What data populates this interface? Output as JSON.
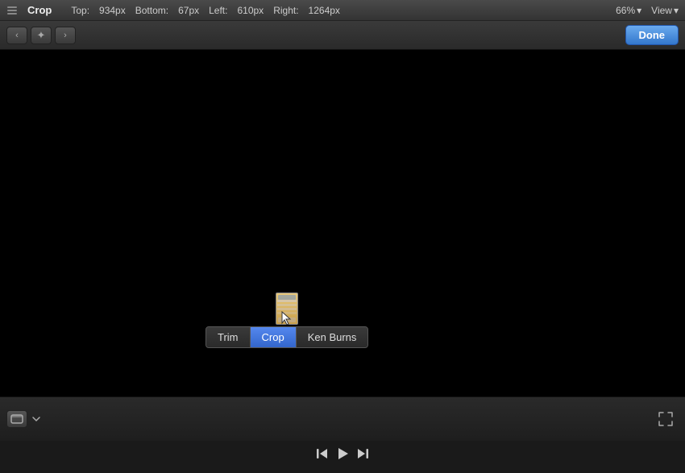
{
  "titlebar": {
    "drag_icon": "drag-icon",
    "title": "Crop",
    "top_label": "Top:",
    "top_value": "934px",
    "bottom_label": "Bottom:",
    "bottom_value": "67px",
    "left_label": "Left:",
    "left_value": "610px",
    "right_label": "Right:",
    "right_value": "1264px",
    "zoom": "66%",
    "zoom_dropdown": "▾",
    "view_label": "View",
    "view_dropdown": "▾"
  },
  "toolbar": {
    "prev_label": "‹",
    "center_label": "✦",
    "next_label": "›",
    "done_label": "Done"
  },
  "popup": {
    "trim_label": "Trim",
    "crop_label": "Crop",
    "ken_burns_label": "Ken Burns"
  },
  "playback": {
    "skip_back_label": "⏮",
    "play_label": "▶",
    "skip_forward_label": "⏭"
  },
  "bottom": {
    "clip_icon": "clip",
    "fullscreen_icon": "⤢"
  }
}
